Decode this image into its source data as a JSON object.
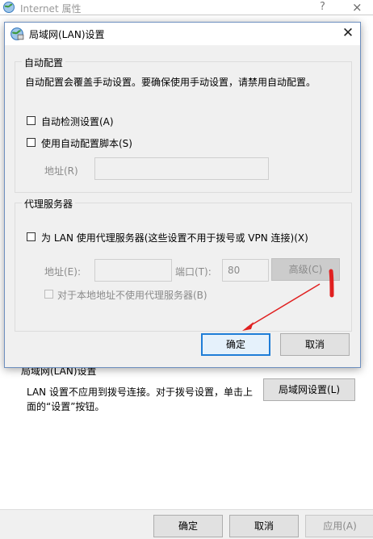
{
  "parent": {
    "title": "Internet 属性",
    "help_glyph": "?",
    "close_glyph": "×",
    "lan_section_title": "局域网(LAN)设置",
    "lan_description": "LAN 设置不应用到拨号连接。对于拨号设置，单击上面的“设置”按钮。",
    "lan_settings_button": "局域网设置(L)",
    "ok_button": "确定",
    "cancel_button": "取消",
    "apply_button": "应用(A)"
  },
  "dialog": {
    "title": "局域网(LAN)设置",
    "close_glyph": "✕",
    "auto_config": {
      "legend": "自动配置",
      "description": "自动配置会覆盖手动设置。要确保使用手动设置，请禁用自动配置。",
      "auto_detect_label": "自动检测设置(A)",
      "auto_detect_checked": false,
      "use_script_label": "使用自动配置脚本(S)",
      "use_script_checked": false,
      "address_label": "地址(R)",
      "address_value": ""
    },
    "proxy": {
      "legend": "代理服务器",
      "use_proxy_label": "为 LAN 使用代理服务器(这些设置不用于拨号或 VPN 连接)(X)",
      "use_proxy_checked": false,
      "address_label": "地址(E):",
      "address_value": "",
      "port_label": "端口(T):",
      "port_value": "80",
      "advanced_button": "高级(C)",
      "bypass_local_label": "对于本地地址不使用代理服务器(B)",
      "bypass_local_checked": false
    },
    "ok_button": "确定",
    "cancel_button": "取消"
  },
  "colors": {
    "annotation_red": "#e02020",
    "focus_blue": "#1e7dd7"
  }
}
